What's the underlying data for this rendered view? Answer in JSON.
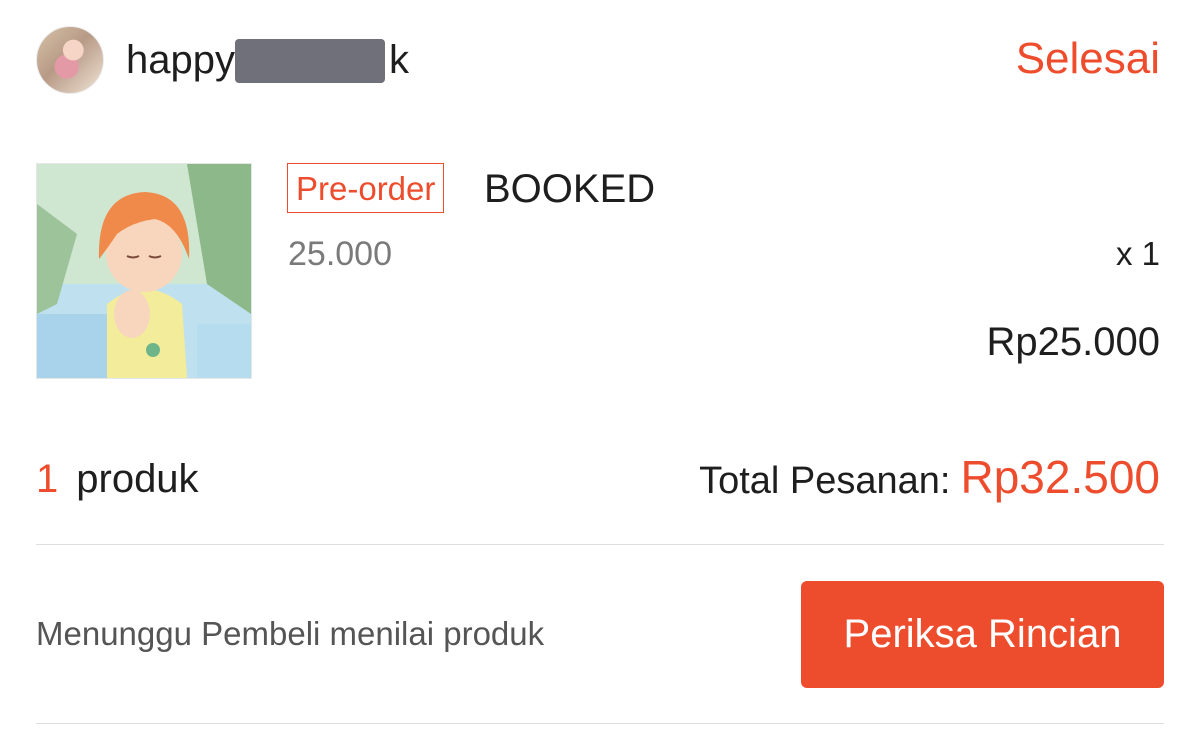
{
  "seller": {
    "avatar_icon": "seller-avatar",
    "username_start": "happy",
    "username_end": "k"
  },
  "order": {
    "status": "Selesai",
    "item": {
      "badge": "Pre-order",
      "name": "BOOKED",
      "unit_price": "25.000",
      "quantity": "x 1",
      "subtotal": "Rp25.000",
      "image_icon": "product-thumbnail"
    },
    "product_count": "1",
    "product_count_label": "produk",
    "total_label": "Total Pesanan:",
    "total_amount": "Rp32.500",
    "note": "Menunggu Pembeli menilai produk",
    "action_label": "Periksa Rincian"
  },
  "colors": {
    "accent": "#ee4d2d"
  }
}
